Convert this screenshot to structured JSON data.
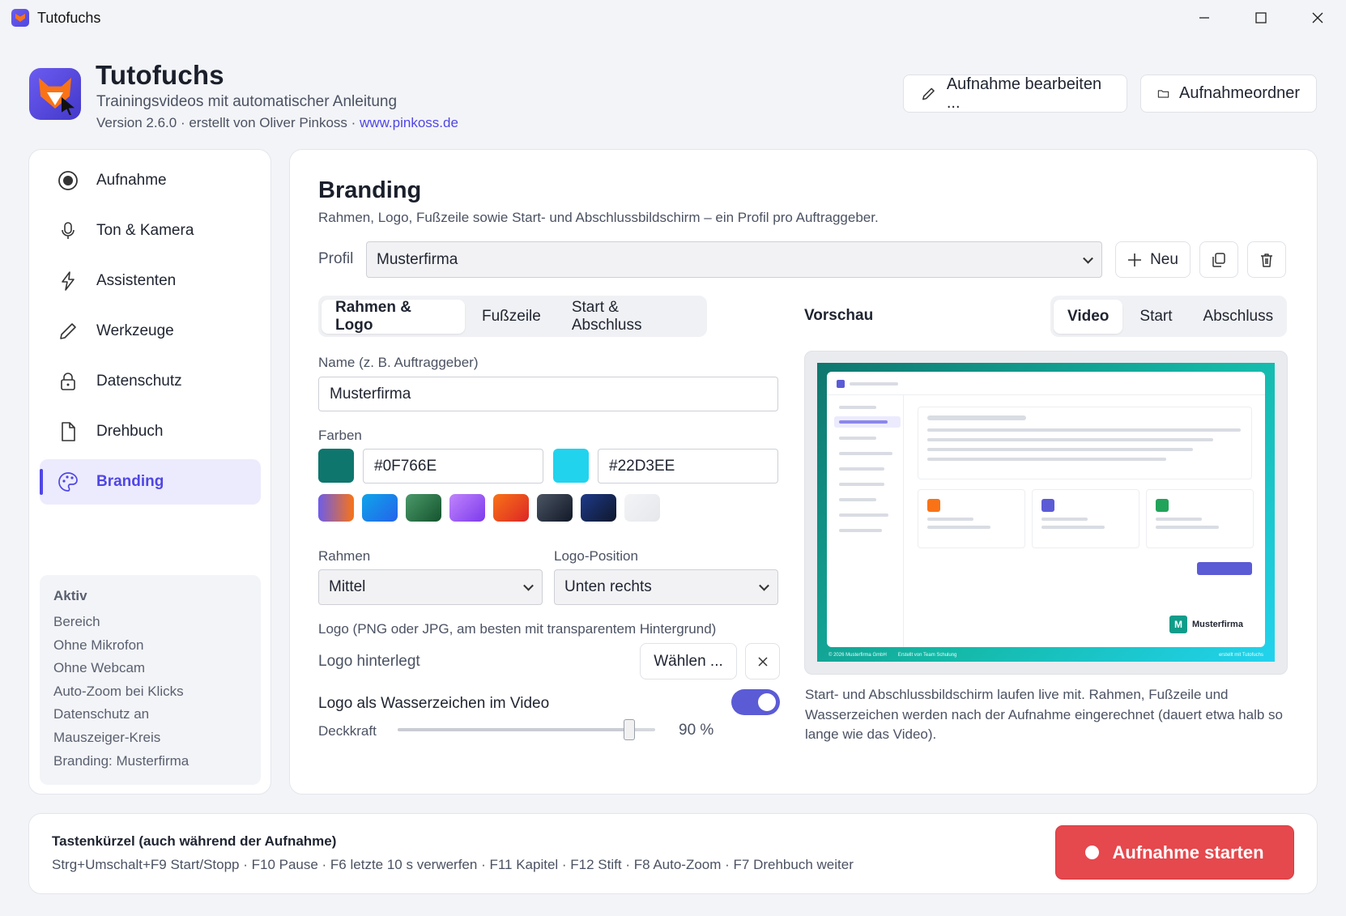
{
  "window": {
    "title": "Tutofuchs"
  },
  "header": {
    "app_name": "Tutofuchs",
    "subtitle": "Trainingsvideos mit automatischer Anleitung",
    "version_text": "Version 2.6.0 · erstellt von Oliver Pinkoss · ",
    "website": "www.pinkoss.de",
    "edit_recording_label": "Aufnahme bearbeiten ...",
    "recording_folder_label": "Aufnahmeordner"
  },
  "sidebar": {
    "items": [
      {
        "label": "Aufnahme",
        "icon": "record-icon"
      },
      {
        "label": "Ton & Kamera",
        "icon": "microphone-icon"
      },
      {
        "label": "Assistenten",
        "icon": "lightning-icon"
      },
      {
        "label": "Werkzeuge",
        "icon": "pencil-icon"
      },
      {
        "label": "Datenschutz",
        "icon": "lock-icon"
      },
      {
        "label": "Drehbuch",
        "icon": "document-icon"
      },
      {
        "label": "Branding",
        "icon": "palette-icon",
        "active": true
      }
    ],
    "status": {
      "heading": "Aktiv",
      "items": [
        "Bereich",
        "Ohne Mikrofon",
        "Ohne Webcam",
        "Auto-Zoom bei Klicks",
        "Datenschutz an",
        "Mauszeiger-Kreis",
        "Branding: Musterfirma"
      ]
    }
  },
  "main": {
    "title": "Branding",
    "description": "Rahmen, Logo, Fußzeile sowie Start- und Abschlussbildschirm – ein Profil pro Auftraggeber.",
    "profile": {
      "label": "Profil",
      "value": "Musterfirma",
      "new_label": "Neu"
    },
    "tabs": [
      {
        "label": "Rahmen & Logo",
        "active": true
      },
      {
        "label": "Fußzeile"
      },
      {
        "label": "Start & Abschluss"
      }
    ],
    "name_field": {
      "label": "Name (z. B. Auftraggeber)",
      "value": "Musterfirma"
    },
    "colors": {
      "label": "Farben",
      "primary": "#0F766E",
      "secondary": "#22D3EE",
      "presets": [
        [
          "#6d5ce8",
          "#f97316"
        ],
        [
          "#0ea5e9",
          "#2563eb"
        ],
        [
          "#4b9a6b",
          "#14532d"
        ],
        [
          "#c084fc",
          "#7c3aed"
        ],
        [
          "#f97316",
          "#dc2626"
        ],
        [
          "#4b5563",
          "#111827"
        ],
        [
          "#1e3a8a",
          "#0f172a"
        ],
        [
          "#f3f4f6",
          "#e5e7eb"
        ]
      ]
    },
    "frame": {
      "label": "Rahmen",
      "value": "Mittel"
    },
    "logo_position": {
      "label": "Logo-Position",
      "value": "Unten rechts"
    },
    "logo": {
      "label": "Logo (PNG oder JPG, am besten mit transparentem Hintergrund)",
      "status": "Logo hinterlegt",
      "choose_label": "Wählen ..."
    },
    "watermark": {
      "label": "Logo als Wasserzeichen im Video",
      "enabled": true,
      "opacity_label": "Deckkraft",
      "opacity_value": 90,
      "opacity_text": "90 %"
    },
    "preview": {
      "label": "Vorschau",
      "tabs": [
        {
          "label": "Video",
          "active": true
        },
        {
          "label": "Start"
        },
        {
          "label": "Abschluss"
        }
      ],
      "company_badge": "M",
      "company_name": "Musterfirma",
      "footer_left": "© 2026 Musterfirma GmbH",
      "footer_mid": "Erstellt von Team Schulung",
      "footer_right": "erstellt mit Tutofuchs",
      "caption": "Start- und Abschlussbildschirm laufen live mit. Rahmen, Fußzeile und Wasserzeichen werden nach der Aufnahme eingerechnet (dauert etwa halb so lange wie das Video)."
    }
  },
  "footer": {
    "shortcuts_title": "Tastenkürzel (auch während der Aufnahme)",
    "shortcuts": "Strg+Umschalt+F9 Start/Stopp · F10 Pause · F6 letzte 10 s verwerfen · F11 Kapitel · F12 Stift · F8 Auto-Zoom · F7 Drehbuch weiter",
    "start_label": "Aufnahme starten"
  },
  "colors": {
    "accent": "#4f46e5",
    "record": "#e5484d",
    "toggle": "#5b5bd6"
  }
}
